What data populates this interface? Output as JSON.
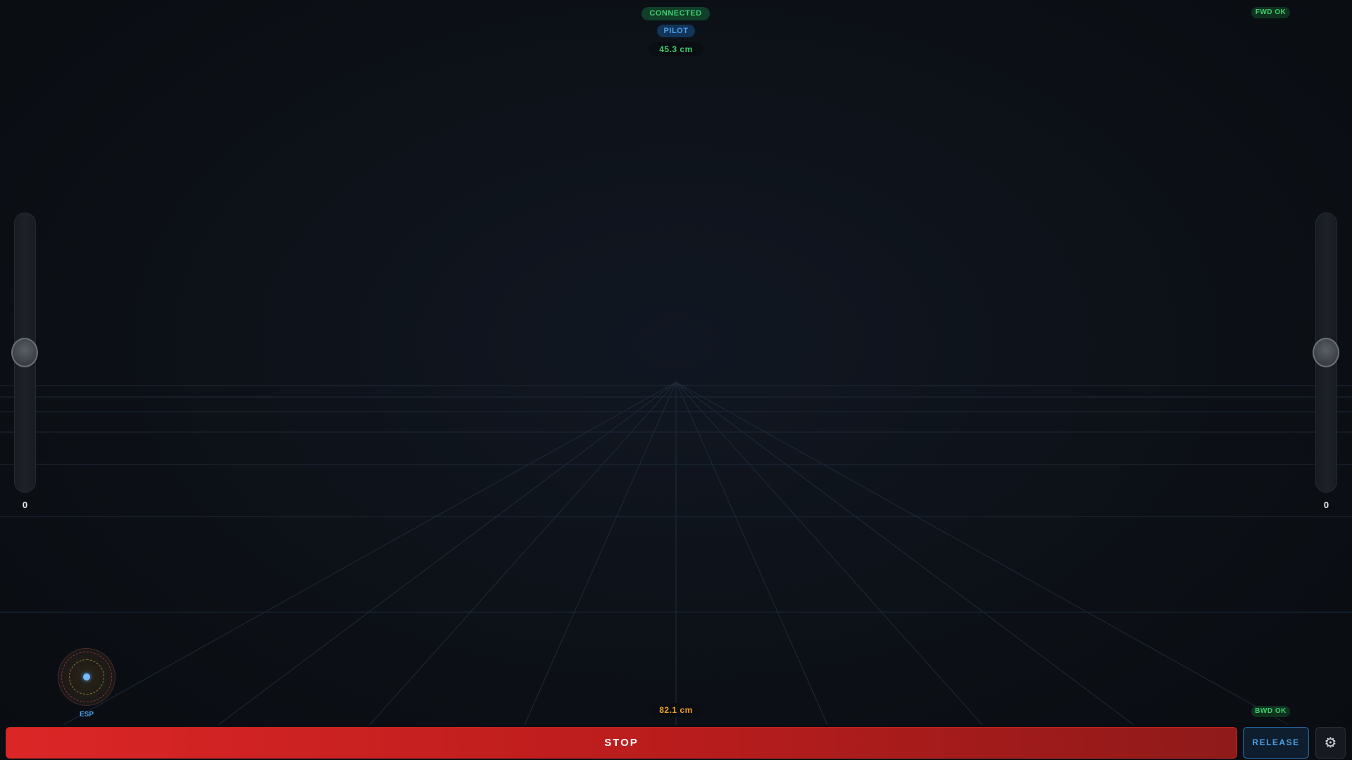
{
  "status": {
    "connection": "CONNECTED",
    "mode": "PILOT",
    "distance_front": "45.3 cm",
    "distance_rear": "82.1 cm",
    "forward_sensor": "FWD OK",
    "backward_sensor": "BWD OK"
  },
  "sliders": {
    "left_value": "0",
    "right_value": "0"
  },
  "joystick": {
    "label": "ESP"
  },
  "controls": {
    "stop_label": "STOP",
    "release_label": "RELEASE",
    "settings_icon": "gear-icon",
    "settings_glyph": "⚙"
  },
  "colors": {
    "ok_green": "#3ecf6a",
    "accent_blue": "#4a9fe8",
    "warn_orange": "#f0a020",
    "stop_red": "#dc2626"
  }
}
